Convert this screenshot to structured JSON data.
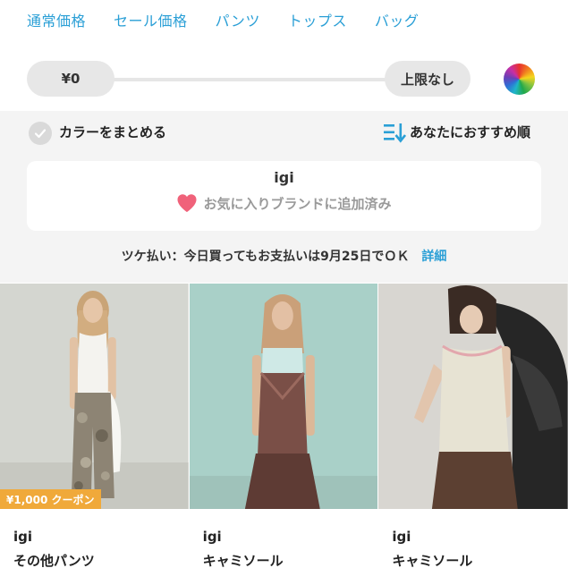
{
  "category_nav": [
    "通常価格",
    "セール価格",
    "パンツ",
    "トップス",
    "バッグ"
  ],
  "price": {
    "min_label": "¥0",
    "max_label": "上限なし"
  },
  "filters": {
    "group_colors_label": "カラーをまとめる",
    "sort_label": "あなたにおすすめ順"
  },
  "brand_card": {
    "name": "igi",
    "favorite_status": "お気に入りブランドに追加済み"
  },
  "payment": {
    "text": "ツケ払い：今日買ってもお支払いは9月25日でＯＫ",
    "link": "詳細"
  },
  "products": [
    {
      "brand": "igi",
      "category": "その他パンツ",
      "coupon": "¥1,000 クーポン"
    },
    {
      "brand": "igi",
      "category": "キャミソール",
      "coupon": ""
    },
    {
      "brand": "igi",
      "category": "キャミソール",
      "coupon": ""
    }
  ],
  "colors": {
    "link": "#2a9fd6",
    "heart": "#f0627a",
    "coupon": "#f0a93a",
    "pill": "#e7e7e7",
    "section_bg": "#f4f4f4"
  }
}
